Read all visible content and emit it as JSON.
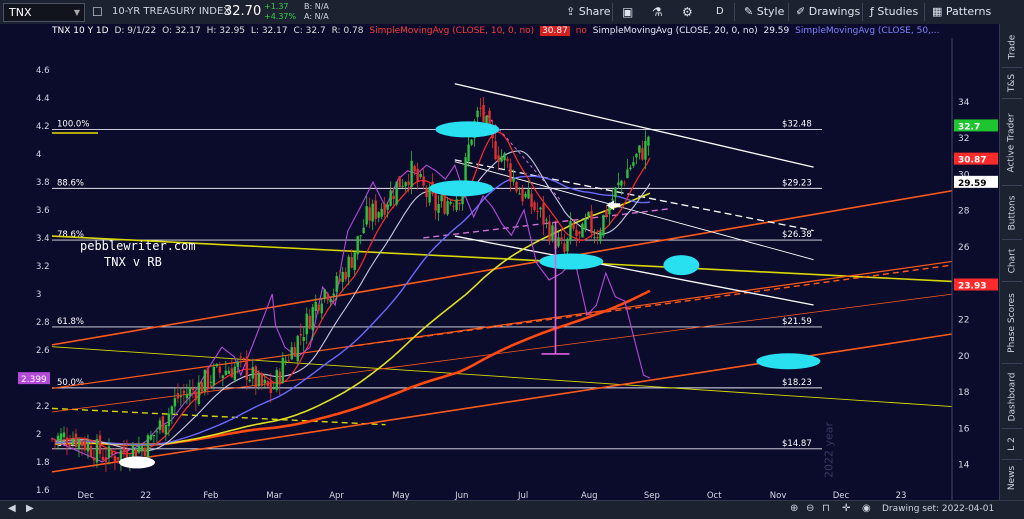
{
  "toolbar": {
    "symbol": "TNX",
    "instrument_name": "10-YR TREASURY INDEX",
    "last_price": "32.70",
    "change_abs": "+1.37",
    "change_pct": "+4.37%",
    "bid": "B: N/A",
    "ask": "A: N/A",
    "share_label": "Share",
    "period_label": "D",
    "style_label": "Style",
    "drawings_label": "Drawings",
    "studies_label": "Studies",
    "patterns_label": "Patterns"
  },
  "header": {
    "title": "TNX 10 Y 1D",
    "date": "D: 9/1/22",
    "open": "O: 32.17",
    "high": "H: 32.95",
    "low": "L: 32.17",
    "close": "C: 32.7",
    "rb": "R: 0.78",
    "sma1": "SimpleMovingAvg (CLOSE, 10, 0, no)",
    "sma1_val": "30.87",
    "sma2": "SimpleMovingAvg (CLOSE, 20, 0, no)",
    "sma2_val": "29.59",
    "sma3": "SimpleMovingAvg (CLOSE, 50,...",
    "no_label": "no"
  },
  "side_tabs": [
    "Trade",
    "T&S",
    "Active Trader",
    "Buttons",
    "Chart",
    "Phase Scores",
    "Dashboard",
    "L 2",
    "News"
  ],
  "bottom": {
    "drawing_set": "Drawing set: 2022-04-01"
  },
  "colors": {
    "background": "#0b0b2c",
    "price_up": "#2fbf3e",
    "price_down": "#e0302e",
    "sma10": "#ff2a2a",
    "sma20": "#c8c8e0",
    "sma50": "#6a6aff",
    "sma100": "#e0e020",
    "sma200": "#ff4a12",
    "rb_ratio": "#b44ad8",
    "ellipse": "#28e0f0",
    "channel": "#ffffff",
    "trendline_yellow": "#d8d800",
    "trendline_orange": "#ff5a1a"
  },
  "chart_data": {
    "type": "line",
    "title": "TNX 10 Y 1D",
    "watermark": "pebblewriter.com",
    "subtitle": "TNX v RB",
    "x_axis": {
      "tick_labels": [
        "Dec",
        "22",
        "Feb",
        "Mar",
        "Apr",
        "May",
        "Jun",
        "Jul",
        "Aug",
        "Sep",
        "Oct",
        "Nov",
        "Dec",
        "23"
      ],
      "tick_months": [
        -1,
        0,
        1,
        2,
        3,
        4,
        5,
        6,
        7,
        8,
        9,
        10,
        11,
        12
      ],
      "range_months": [
        -1.5,
        12.8
      ],
      "year_watermark": "2022 year"
    },
    "left_axis": {
      "label": "RB",
      "range": [
        1.6,
        4.8
      ],
      "ticks": [
        1.6,
        1.8,
        2,
        2.2,
        2.4,
        2.6,
        2.8,
        3,
        3.2,
        3.4,
        3.6,
        3.8,
        4,
        4.2,
        4.4,
        4.6
      ],
      "tick_labels": [
        "1.6",
        "1.8",
        "2",
        "2.2",
        "2.4",
        "2.6",
        "2.8",
        "3",
        "3.2",
        "3.4",
        "3.6",
        "3.8",
        "4",
        "4.2",
        "4.4",
        "4.6"
      ],
      "current_badge": "2.399",
      "current_value": 2.399,
      "reference_line": {
        "label": "",
        "value": 4.15
      }
    },
    "right_axis": {
      "label": "TNX",
      "range": [
        12.6,
        37.3
      ],
      "ticks": [
        14,
        16,
        18,
        20,
        22,
        24,
        26,
        28,
        30,
        32,
        34
      ],
      "tick_labels": [
        "14",
        "16",
        "18",
        "20",
        "22",
        "24",
        "26",
        "28",
        "30",
        "32",
        "34"
      ],
      "badges": [
        {
          "label": "32.7",
          "value": 32.7,
          "color": "#1fc431"
        },
        {
          "label": "30.87",
          "value": 30.87,
          "color": "#ff2a2a"
        },
        {
          "label": "29.59",
          "value": 29.59,
          "color": "#ffffff"
        },
        {
          "label": "23.93",
          "value": 23.93,
          "color": "#ff2a2a"
        }
      ]
    },
    "fib_levels": [
      {
        "pct": "100.0%",
        "price": "$32.48",
        "value": 32.48
      },
      {
        "pct": "88.6%",
        "price": "$29.23",
        "value": 29.23
      },
      {
        "pct": "78.6%",
        "price": "$26.38",
        "value": 26.38
      },
      {
        "pct": "61.8%",
        "price": "$21.59",
        "value": 21.59
      },
      {
        "pct": "50.0%",
        "price": "$18.23",
        "value": 18.23
      },
      {
        "pct": "38.2%",
        "price": "$14.87",
        "value": 14.87
      }
    ],
    "tnx_close_anchors": [
      [
        -1.5,
        15.4
      ],
      [
        -1.2,
        15.6
      ],
      [
        -0.9,
        15.0
      ],
      [
        -0.6,
        14.4
      ],
      [
        -0.3,
        14.8
      ],
      [
        0.0,
        15.1
      ],
      [
        0.25,
        16.3
      ],
      [
        0.5,
        17.7
      ],
      [
        0.8,
        18.2
      ],
      [
        1.0,
        18.8
      ],
      [
        1.3,
        19.3
      ],
      [
        1.55,
        19.4
      ],
      [
        1.8,
        18.3
      ],
      [
        2.0,
        18.1
      ],
      [
        2.2,
        19.7
      ],
      [
        2.5,
        21.5
      ],
      [
        2.8,
        23.6
      ],
      [
        3.0,
        23.7
      ],
      [
        3.25,
        25.3
      ],
      [
        3.5,
        27.6
      ],
      [
        3.75,
        28.3
      ],
      [
        4.0,
        29.5
      ],
      [
        4.2,
        30.2
      ],
      [
        4.35,
        29.4
      ],
      [
        4.6,
        28.2
      ],
      [
        4.8,
        28.6
      ],
      [
        5.0,
        29.0
      ],
      [
        5.15,
        32.1
      ],
      [
        5.3,
        33.6
      ],
      [
        5.5,
        31.6
      ],
      [
        5.7,
        30.8
      ],
      [
        5.9,
        29.2
      ],
      [
        6.1,
        28.4
      ],
      [
        6.3,
        27.6
      ],
      [
        6.5,
        26.4
      ],
      [
        6.65,
        25.6
      ],
      [
        6.75,
        27.0
      ],
      [
        6.9,
        26.3
      ],
      [
        7.0,
        27.4
      ],
      [
        7.15,
        26.7
      ],
      [
        7.35,
        28.3
      ],
      [
        7.5,
        29.3
      ],
      [
        7.65,
        30.3
      ],
      [
        7.8,
        31.0
      ],
      [
        7.95,
        31.6
      ],
      [
        8.0,
        32.7
      ]
    ],
    "rb_anchors": [
      [
        -1.5,
        1.97
      ],
      [
        -1.3,
        1.92
      ],
      [
        -1.1,
        1.88
      ],
      [
        -0.9,
        1.84
      ],
      [
        -0.7,
        1.8
      ],
      [
        -0.5,
        1.86
      ],
      [
        -0.3,
        1.88
      ],
      [
        -0.1,
        1.92
      ],
      [
        0.0,
        1.95
      ],
      [
        0.2,
        2.05
      ],
      [
        0.4,
        2.1
      ],
      [
        0.6,
        2.22
      ],
      [
        0.8,
        2.32
      ],
      [
        1.0,
        2.48
      ],
      [
        1.2,
        2.62
      ],
      [
        1.4,
        2.55
      ],
      [
        1.5,
        2.42
      ],
      [
        1.7,
        2.65
      ],
      [
        1.9,
        2.88
      ],
      [
        2.0,
        3.0
      ],
      [
        2.05,
        2.78
      ],
      [
        2.2,
        2.62
      ],
      [
        2.4,
        2.55
      ],
      [
        2.6,
        2.62
      ],
      [
        2.8,
        3.05
      ],
      [
        3.0,
        2.92
      ],
      [
        3.1,
        3.22
      ],
      [
        3.2,
        3.45
      ],
      [
        3.4,
        3.62
      ],
      [
        3.6,
        3.8
      ],
      [
        3.8,
        3.62
      ],
      [
        4.0,
        3.82
      ],
      [
        4.15,
        3.88
      ],
      [
        4.3,
        3.86
      ],
      [
        4.45,
        3.92
      ],
      [
        4.6,
        3.88
      ],
      [
        4.75,
        3.82
      ],
      [
        4.9,
        3.92
      ],
      [
        5.05,
        3.72
      ],
      [
        5.2,
        3.55
      ],
      [
        5.35,
        3.7
      ],
      [
        5.5,
        3.62
      ],
      [
        5.65,
        3.5
      ],
      [
        5.8,
        3.42
      ],
      [
        6.0,
        3.6
      ],
      [
        6.2,
        3.22
      ],
      [
        6.4,
        3.1
      ],
      [
        6.6,
        3.15
      ],
      [
        6.8,
        3.25
      ],
      [
        7.0,
        2.85
      ],
      [
        7.15,
        2.92
      ],
      [
        7.3,
        3.15
      ],
      [
        7.45,
        2.98
      ],
      [
        7.6,
        2.95
      ],
      [
        7.75,
        2.68
      ],
      [
        7.9,
        2.42
      ],
      [
        8.0,
        2.4
      ]
    ]
  }
}
